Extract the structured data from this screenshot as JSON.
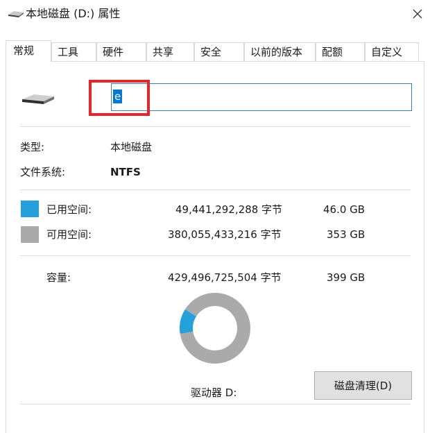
{
  "window": {
    "title": "本地磁盘 (D:) 属性",
    "close_glyph": "✕"
  },
  "tabs": [
    {
      "label": "常规",
      "active": true
    },
    {
      "label": "工具"
    },
    {
      "label": "硬件"
    },
    {
      "label": "共享"
    },
    {
      "label": "安全"
    },
    {
      "label": "以前的版本"
    },
    {
      "label": "配额"
    },
    {
      "label": "自定义"
    }
  ],
  "general": {
    "drive_icon": "drive-icon",
    "name_value": "e",
    "type_label": "类型:",
    "type_value": "本地磁盘",
    "fs_label": "文件系统:",
    "fs_value": "NTFS",
    "used": {
      "label": "已用空间:",
      "bytes": "49,441,292,288 字节",
      "size": "46.0 GB",
      "color": "#26a0da"
    },
    "free": {
      "label": "可用空间:",
      "bytes": "380,055,433,216 字节",
      "size": "353 GB",
      "color": "#aaaaaa"
    },
    "capacity": {
      "label": "容量:",
      "bytes": "429,496,725,504 字节",
      "size": "399 GB"
    },
    "drive_label": "驱动器 D:",
    "cleanup_button": "磁盘清理(D)"
  },
  "chart_data": {
    "type": "pie",
    "categories": [
      "已用空间",
      "可用空间"
    ],
    "values": [
      49441292288,
      380055433216
    ],
    "colors": [
      "#26a0da",
      "#aaaaaa"
    ]
  }
}
